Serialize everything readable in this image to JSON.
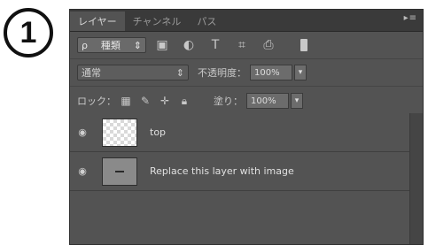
{
  "step_badge": "1",
  "tabs": [
    {
      "label": "レイヤー",
      "active": true
    },
    {
      "label": "チャンネル",
      "active": false
    },
    {
      "label": "パス",
      "active": false
    }
  ],
  "panel_menu_glyph": "▸≡",
  "filter": {
    "kind_label": "種類",
    "kind_glyph": "ρ",
    "icons": [
      "image-filter-icon",
      "adjustment-filter-icon",
      "type-filter-icon",
      "shape-filter-icon",
      "smart-object-filter-icon"
    ]
  },
  "blend": {
    "mode": "通常",
    "opacity_label": "不透明度：",
    "opacity_value": "100%"
  },
  "lock": {
    "label": "ロック：",
    "fill_label": "塗り：",
    "fill_value": "100%"
  },
  "layers": [
    {
      "name": "top",
      "thumb": "transparent"
    },
    {
      "name": "Replace this layer with image",
      "thumb": "gray"
    }
  ],
  "colors": {
    "panel_bg": "#535353",
    "tabbar_bg": "#3a3a3a"
  }
}
